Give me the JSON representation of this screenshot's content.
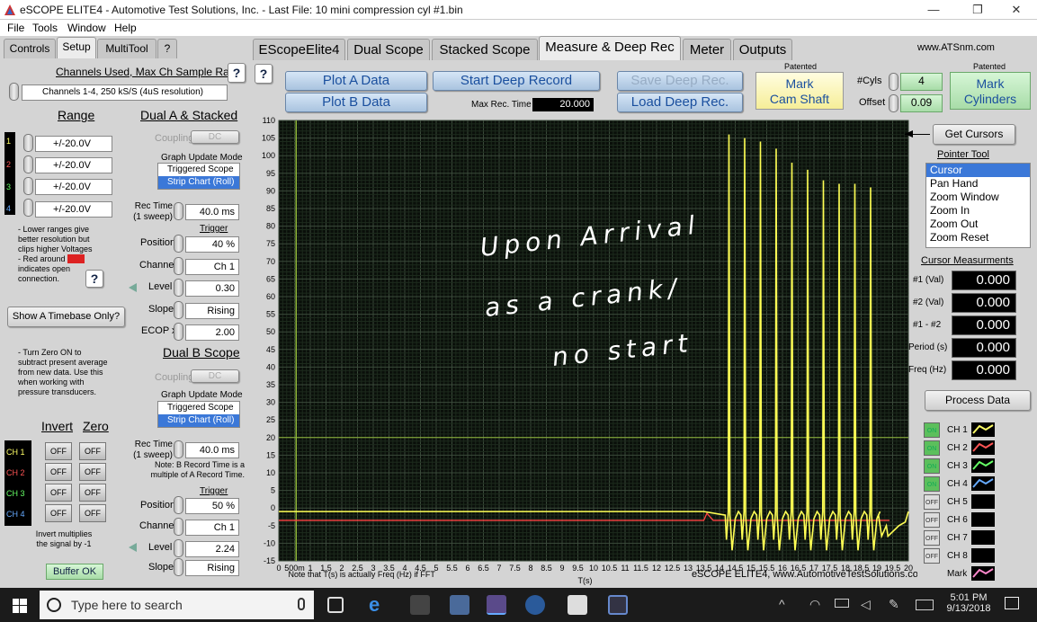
{
  "window": {
    "title": "eSCOPE ELITE4 - Automotive Test Solutions, Inc. - Last File: 10 mini compression cyl #1.bin"
  },
  "menu": [
    "File",
    "Tools",
    "Window",
    "Help"
  ],
  "left_tabs": [
    "Controls",
    "Setup",
    "MultiTool",
    "?"
  ],
  "main_tabs": [
    "EScopeElite4",
    "Dual Scope",
    "Stacked Scope",
    "Measure & Deep Rec",
    "Meter",
    "Outputs"
  ],
  "website": "www.ATSnm.com",
  "help_q": "?",
  "channels": {
    "title": "Channels Used, Max Ch Sample Rate",
    "value": "Channels 1-4, 250 kS/S (4uS resolution)"
  },
  "range": {
    "title": "Range",
    "ch_nums": [
      "1",
      "2",
      "3",
      "4"
    ],
    "values": [
      "+/-20.0V",
      "+/-20.0V",
      "+/-20.0V",
      "+/-20.0V"
    ],
    "note1": "- Lower ranges give better resolution but clips higher Voltages",
    "note2": "- Red around",
    "note2_box": "ch#",
    "note3": "indicates open connection."
  },
  "dual_a": {
    "title": "Dual A & Stacked",
    "coupling_label": "Coupling",
    "coupling": "DC",
    "graph_mode_label": "Graph Update Mode",
    "mode_opts": [
      "Triggered Scope",
      "Strip Chart (Roll)"
    ],
    "rec_time_label": "Rec Time\n(1 sweep)",
    "rec_time": "40.0 ms",
    "trigger": "Trigger",
    "position_label": "Position",
    "position": "40 %",
    "channel_label": "Channel",
    "channel": "Ch 1",
    "level_label": "Level",
    "level": "0.30",
    "slope_label": "Slope",
    "slope": "Rising",
    "ecop_label": "ECOP x",
    "ecop": "2.00"
  },
  "timebase_btn": "Show A Timebase Only?",
  "zero_note": "- Turn Zero ON to subtract present average from new data. Use this when working with pressure transducers.",
  "dual_b": {
    "title": "Dual B Scope",
    "coupling_label": "Coupling",
    "coupling": "DC",
    "graph_mode_label": "Graph Update Mode",
    "mode_opts": [
      "Triggered Scope",
      "Strip Chart (Roll)"
    ],
    "rec_time_label": "Rec Time\n(1 sweep)",
    "rec_time": "40.0 ms",
    "note": "Note: B Record Time is a multiple of A Record Time.",
    "trigger": "Trigger",
    "position_label": "Position",
    "position": "50 %",
    "channel_label": "Channel",
    "channel": "Ch 1",
    "level_label": "Level",
    "level": "2.24",
    "slope_label": "Slope",
    "slope": "Rising"
  },
  "invert_zero": {
    "invert": "Invert",
    "zero": "Zero",
    "chs": [
      "CH 1",
      "CH 2",
      "CH 3",
      "CH 4"
    ],
    "ch_colors": [
      "#ffff66",
      "#ff5555",
      "#66ff66",
      "#66aaff"
    ],
    "off": "OFF",
    "note": "Invert multiplies the signal by -1"
  },
  "buffer": "Buffer OK",
  "plot_a": "Plot A Data",
  "plot_b": "Plot B Data",
  "start_deep": "Start Deep Record",
  "save_deep": "Save Deep Rec.",
  "load_deep": "Load Deep Rec.",
  "max_rec_label": "Max Rec. Time",
  "max_rec": "20.000",
  "patented": "Patented",
  "mark_cam": "Mark\nCam Shaft",
  "cyls_label": "#Cyls",
  "cyls": "4",
  "offset_label": "Offset",
  "offset": "0.09",
  "mark_cyl": "Mark\nCylinders",
  "get_cursors": "Get Cursors",
  "pointer_tool": "Pointer Tool",
  "pointer_items": [
    "Cursor",
    "Pan Hand",
    "Zoom Window",
    "Zoom In",
    "Zoom Out",
    "Zoom Reset"
  ],
  "cursor_meas": {
    "title": "Cursor Measurments",
    "labels": [
      "#1 (Val)",
      "#2 (Val)",
      "#1 - #2",
      "Period (s)",
      "Freq (Hz)"
    ],
    "values": [
      "0.000",
      "0.000",
      "0.000",
      "0.000",
      "0.000"
    ]
  },
  "process": "Process Data",
  "legend": {
    "states": [
      "ON",
      "ON",
      "ON",
      "ON",
      "OFF",
      "OFF",
      "OFF",
      "OFF"
    ],
    "names": [
      "CH 1",
      "CH 2",
      "CH 3",
      "CH 4",
      "CH 5",
      "CH 6",
      "CH 7",
      "CH 8"
    ],
    "colors": [
      "#ffff66",
      "#ff5555",
      "#66ff66",
      "#66aaff",
      "#000",
      "#000",
      "#000",
      "#000"
    ],
    "mark": "Mark"
  },
  "chart_data": {
    "type": "line",
    "xlabel": "T(s)",
    "xlim": [
      0,
      20
    ],
    "ylim": [
      -15,
      110
    ],
    "y_ticks": [
      -15,
      -10,
      -5,
      0,
      5,
      10,
      15,
      20,
      25,
      30,
      35,
      40,
      45,
      50,
      55,
      60,
      65,
      70,
      75,
      80,
      85,
      90,
      95,
      100,
      105,
      110
    ],
    "x_tick_labels": [
      "0",
      "500m",
      "1",
      "1.5",
      "2",
      "2.5",
      "3",
      "3.5",
      "4",
      "4.5",
      "5",
      "5.5",
      "6",
      "6.5",
      "7",
      "7.5",
      "8",
      "8.5",
      "9",
      "9.5",
      "10",
      "10.5",
      "11",
      "11.5",
      "12",
      "12.5",
      "13",
      "13.5",
      "14",
      "14.5",
      "15",
      "15.5",
      "16",
      "16.5",
      "17",
      "17.5",
      "18",
      "18.5",
      "19",
      "19.5",
      "20"
    ],
    "series": [
      {
        "color": "#ffff55",
        "baseline": -1.0,
        "peaks": [
          [
            14.3,
            106
          ],
          [
            14.8,
            105
          ],
          [
            15.3,
            104
          ],
          [
            15.8,
            102
          ],
          [
            16.3,
            98
          ],
          [
            16.8,
            96
          ],
          [
            17.3,
            93
          ],
          [
            17.8,
            92
          ],
          [
            18.3,
            92
          ],
          [
            18.8,
            91
          ],
          [
            19.2,
            -3
          ]
        ]
      },
      {
        "color": "#ff4444",
        "baseline": -3.5
      }
    ],
    "cursor_x": 0.55,
    "cursor_y": 20,
    "footnote": "Note that T(s) is actually Freq (Hz) if FFT",
    "credit": "eSCOPE ELITE4, www.AutomotiveTestSolutions.com",
    "handwriting": [
      "Upon Arrival",
      "as a crank/",
      "no start"
    ]
  },
  "taskbar": {
    "search": "Type here to search",
    "time": "5:01 PM",
    "date": "9/13/2018"
  }
}
